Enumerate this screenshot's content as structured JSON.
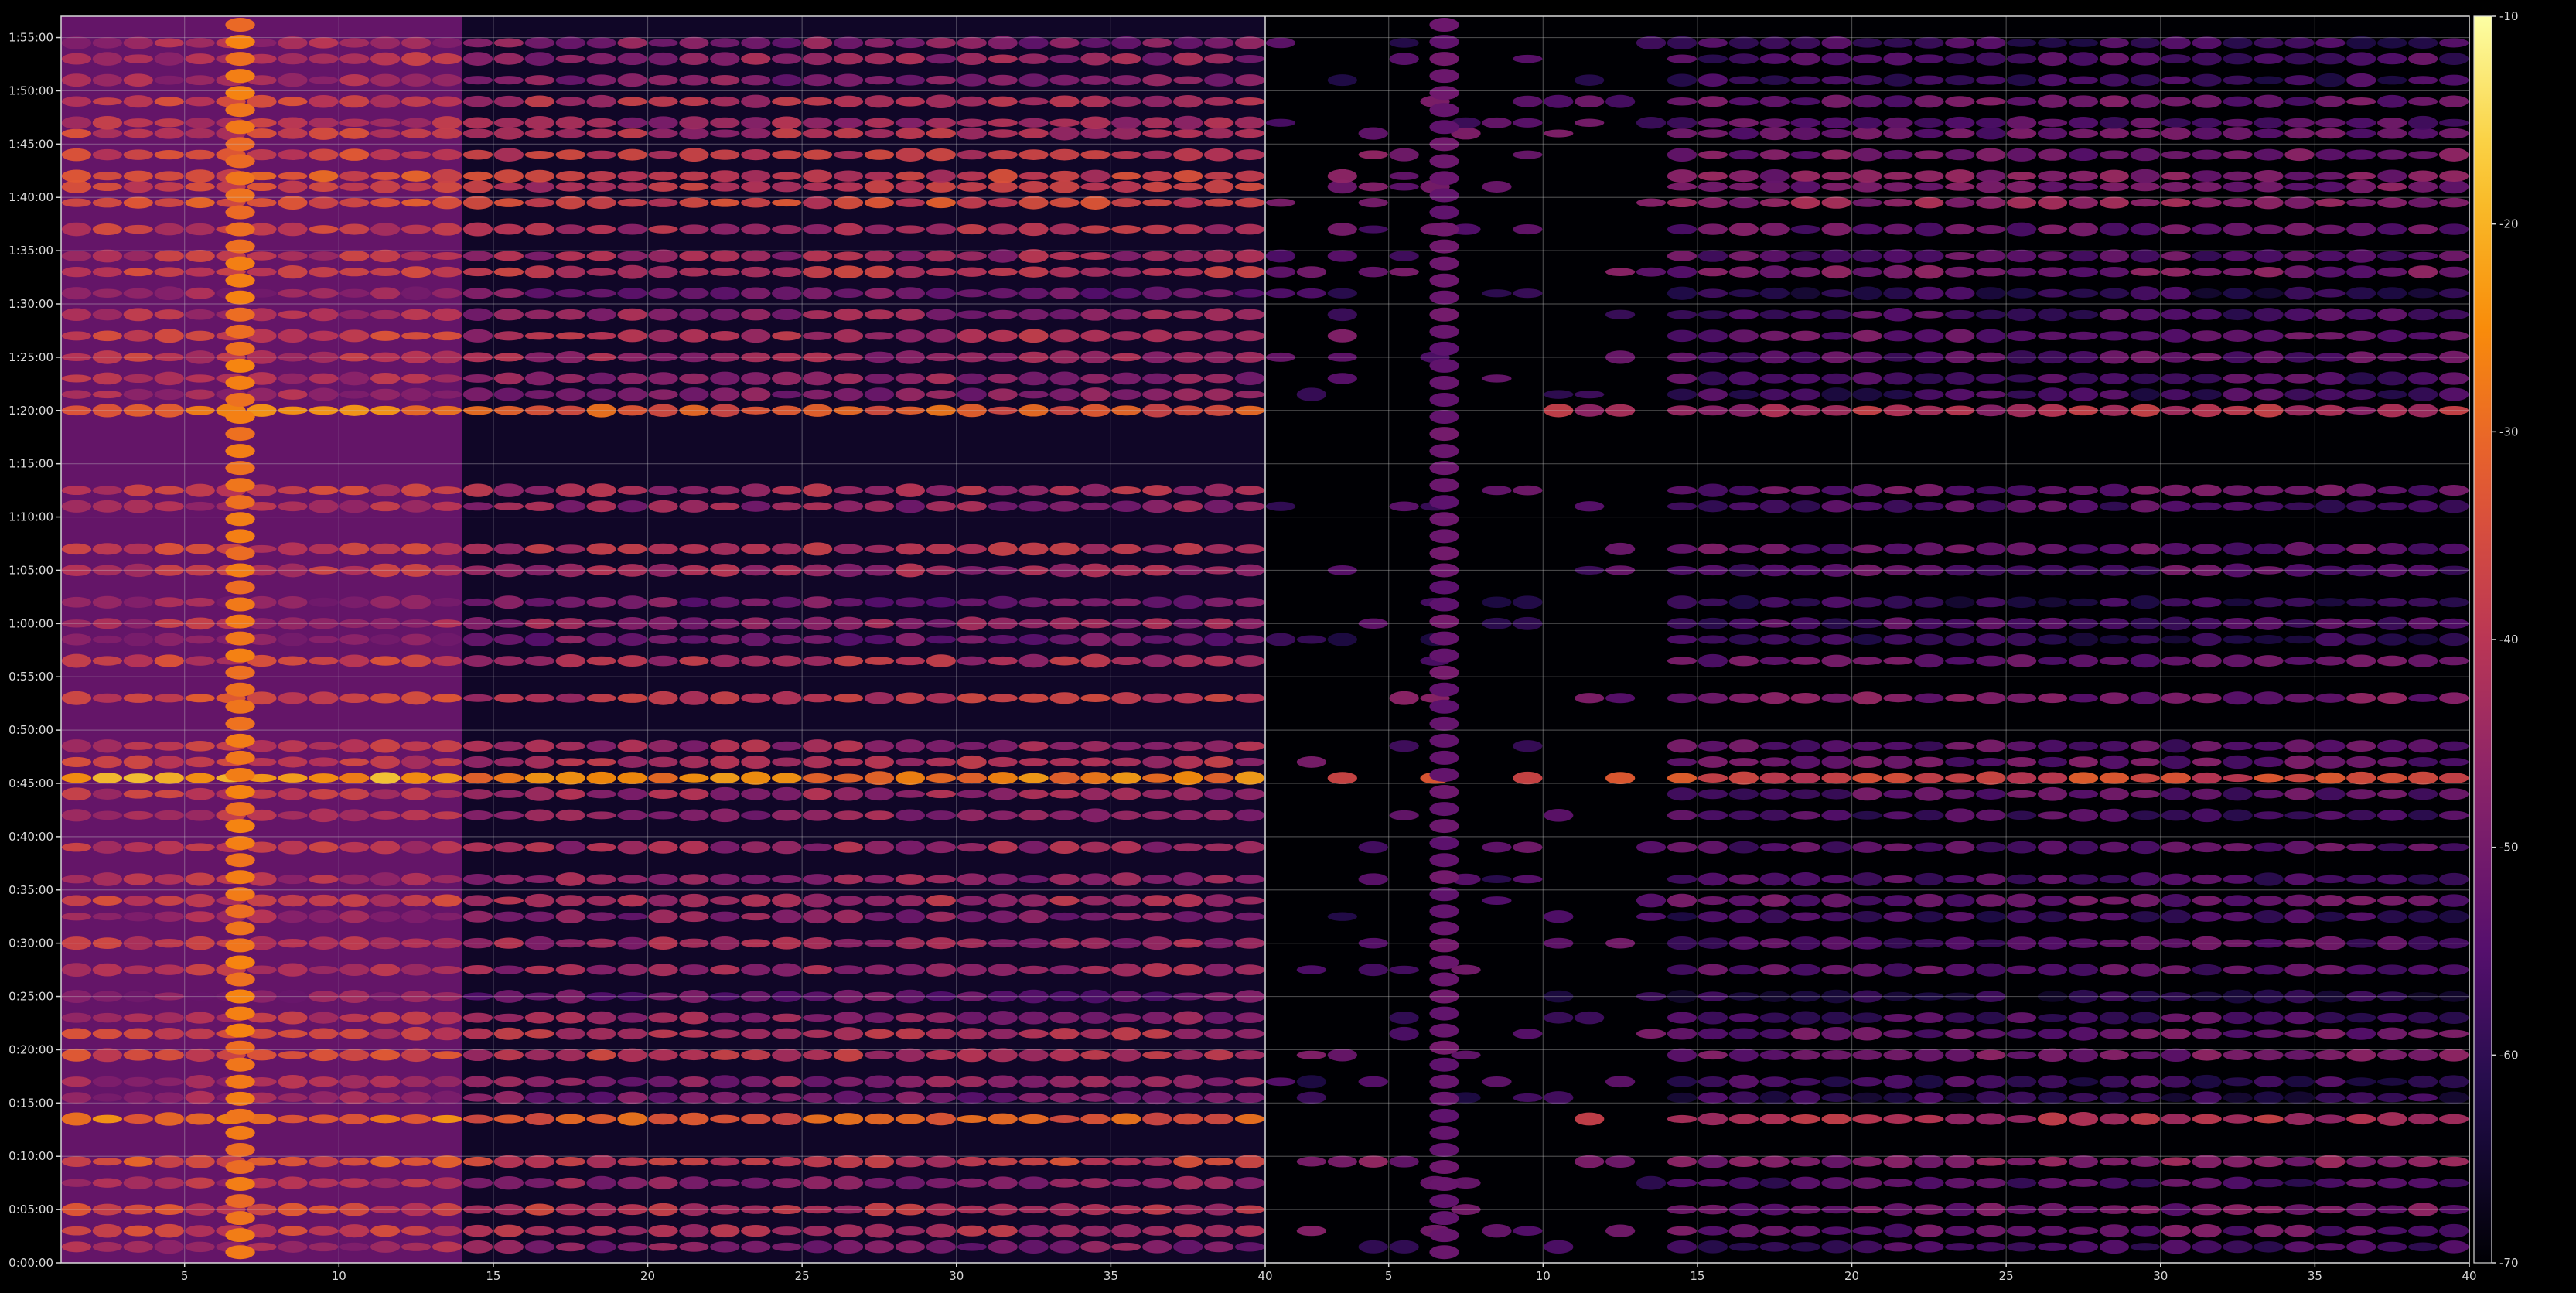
{
  "chart_data": {
    "type": "heatmap",
    "title": "",
    "xlabel": "",
    "ylabel": "",
    "grid": true,
    "background": "#000000",
    "colormap": "inferno",
    "colorbar": {
      "range": [
        -70,
        -10
      ],
      "ticks": [
        "-10",
        "-20",
        "-30",
        "-40",
        "-50",
        "-60",
        "-70"
      ]
    },
    "panels": [
      {
        "name": "left",
        "xlim": [
          1,
          40
        ],
        "x_ticks": [
          "5",
          "10",
          "15",
          "20",
          "25",
          "30",
          "35",
          "40"
        ],
        "offset_db": 0,
        "floor_db": -66
      },
      {
        "name": "right",
        "xlim": [
          1,
          40
        ],
        "x_ticks": [
          "5",
          "10",
          "15",
          "20",
          "25",
          "30",
          "35",
          "40"
        ],
        "offset_db": -10,
        "floor_db": -70
      }
    ],
    "ylim_minutes": [
      0,
      117
    ],
    "y_ticks": [
      "0:00:00",
      "0:05:00",
      "0:10:00",
      "0:15:00",
      "0:20:00",
      "0:25:00",
      "0:30:00",
      "0:35:00",
      "0:40:00",
      "0:45:00",
      "0:50:00",
      "0:55:00",
      "1:00:00",
      "1:05:00",
      "1:10:00",
      "1:15:00",
      "1:20:00",
      "1:25:00",
      "1:30:00",
      "1:35:00",
      "1:40:00",
      "1:45:00",
      "1:50:00",
      "1:55:00"
    ],
    "row_events": [
      {
        "t": 1.5,
        "db": -48
      },
      {
        "t": 3.0,
        "db": -42
      },
      {
        "t": 5.0,
        "db": -40
      },
      {
        "t": 7.5,
        "db": -46
      },
      {
        "t": 9.5,
        "db": -38
      },
      {
        "t": 13.5,
        "db": -32
      },
      {
        "t": 15.5,
        "db": -50
      },
      {
        "t": 17.0,
        "db": -48
      },
      {
        "t": 19.5,
        "db": -40
      },
      {
        "t": 21.5,
        "db": -42
      },
      {
        "t": 23.0,
        "db": -46
      },
      {
        "t": 25.0,
        "db": -52
      },
      {
        "t": 27.5,
        "db": -44
      },
      {
        "t": 30.0,
        "db": -44
      },
      {
        "t": 32.5,
        "db": -48
      },
      {
        "t": 34.0,
        "db": -42
      },
      {
        "t": 36.0,
        "db": -46
      },
      {
        "t": 39.0,
        "db": -44
      },
      {
        "t": 42.0,
        "db": -46
      },
      {
        "t": 44.0,
        "db": -44
      },
      {
        "t": 45.5,
        "db": -26
      },
      {
        "t": 47.0,
        "db": -42
      },
      {
        "t": 48.5,
        "db": -44
      },
      {
        "t": 53.0,
        "db": -40
      },
      {
        "t": 56.5,
        "db": -42
      },
      {
        "t": 58.5,
        "db": -50
      },
      {
        "t": 60.0,
        "db": -46
      },
      {
        "t": 62.0,
        "db": -50
      },
      {
        "t": 65.0,
        "db": -44
      },
      {
        "t": 67.0,
        "db": -42
      },
      {
        "t": 71.0,
        "db": -46
      },
      {
        "t": 72.5,
        "db": -42
      },
      {
        "t": 80.0,
        "db": -32
      },
      {
        "t": 81.5,
        "db": -48
      },
      {
        "t": 83.0,
        "db": -46
      },
      {
        "t": 85.0,
        "db": -44
      },
      {
        "t": 87.0,
        "db": -42
      },
      {
        "t": 89.0,
        "db": -46
      },
      {
        "t": 91.0,
        "db": -50
      },
      {
        "t": 93.0,
        "db": -40
      },
      {
        "t": 94.5,
        "db": -44
      },
      {
        "t": 97.0,
        "db": -42
      },
      {
        "t": 99.5,
        "db": -36
      },
      {
        "t": 101.0,
        "db": -40
      },
      {
        "t": 102.0,
        "db": -38
      },
      {
        "t": 104.0,
        "db": -40
      },
      {
        "t": 106.0,
        "db": -42
      },
      {
        "t": 107.0,
        "db": -44
      },
      {
        "t": 109.0,
        "db": -42
      },
      {
        "t": 111.0,
        "db": -48
      },
      {
        "t": 113.0,
        "db": -46
      },
      {
        "t": 114.5,
        "db": -48
      }
    ],
    "hot_column": {
      "x": 6.8,
      "db": -28
    },
    "dense_region": {
      "x_end": 14,
      "db": -52
    }
  }
}
